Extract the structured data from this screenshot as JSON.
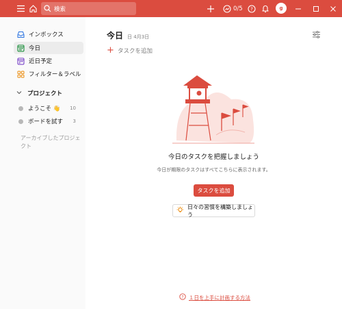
{
  "topbar": {
    "search_placeholder": "検索",
    "progress": "0/5",
    "avatar_initial": "g",
    "colors": {
      "brand": "#db4c3f"
    }
  },
  "sidebar": {
    "items": [
      {
        "label": "インボックス",
        "icon": "inbox-icon",
        "color": "#246fe0"
      },
      {
        "label": "今日",
        "icon": "calendar-today-icon",
        "color": "#058527"
      },
      {
        "label": "近日予定",
        "icon": "calendar-upcoming-icon",
        "color": "#692fc2"
      },
      {
        "label": "フィルター＆ラベル",
        "icon": "filters-labels-icon",
        "color": "#eb8909"
      }
    ],
    "projects_label": "プロジェクト",
    "projects": [
      {
        "label": "ようこそ 👋",
        "count": "10"
      },
      {
        "label": "ボードを試す",
        "count": "3"
      }
    ],
    "archived_label": "アーカイブしたプロジェクト"
  },
  "main": {
    "title": "今日",
    "date": "日 4月3日",
    "add_task_label": "タスクを追加",
    "empty_title": "今日のタスクを把握しましょう",
    "empty_desc": "今日が期限のタスクはすべてこちらに表示されます。",
    "cta_label": "タスクを追加",
    "habit_label": "日々の習慣を構築しましょう",
    "help_link": "１日を上手に計画する方法"
  }
}
